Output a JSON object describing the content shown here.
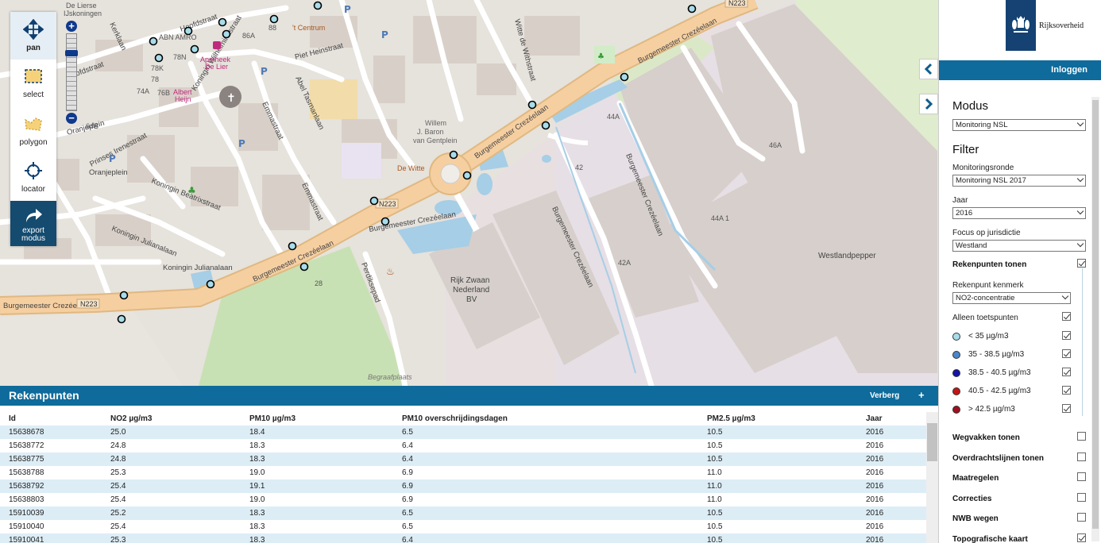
{
  "toolbar": {
    "pan": "pan",
    "select": "select",
    "polygon": "polygon",
    "locator": "locator",
    "export_line1": "export",
    "export_line2": "modus"
  },
  "map": {
    "streets": [
      "Hoofdstraat",
      "Piet Heinstraat",
      "Abel Tasmanlaan",
      "Emmastraat",
      "Koningin Wilhelminastraat",
      "Koningin Beatrixstraat",
      "Koningin Julianalaan",
      "Prinses Irenestraat",
      "Oranjeplein",
      "Witte de Withstraat",
      "Burgemeester Crezéelaan",
      "Burgemeester Crezéelaan",
      "Burgemeester Crezéelaan",
      "Burgemeester Crezéelaan",
      "Burgemeester Crezéelaan",
      "Burgemeester Crezéelaan",
      "Burgemeester Crezéelaan",
      "Perdiksepad",
      "Oranjeplein",
      "Kerklaan"
    ],
    "pois": [
      "ABN AMRO",
      "Apotheek De Lier",
      "Albert Heijn",
      "De Lierse IJskoningen",
      "'t Centrum",
      "Willem J. Baron van Gentplein",
      "De Witte",
      "Rijk Zwaan Nederland BV",
      "Westlandpepper",
      "Begraafplaats"
    ],
    "road_badges": [
      "N223",
      "N223",
      "N223"
    ],
    "house_numbers": [
      "78N",
      "78K",
      "76B",
      "64B",
      "86A",
      "88",
      "42",
      "44A",
      "46A",
      "44A 1",
      "42A",
      "28",
      "74A",
      "78"
    ]
  },
  "panel": {
    "logo_text": "Rijksoverheid",
    "login": "Inloggen",
    "modus_title": "Modus",
    "modus_value": "Monitoring NSL",
    "filter_title": "Filter",
    "ronde_label": "Monitoringsronde",
    "ronde_value": "Monitoring NSL 2017",
    "jaar_label": "Jaar",
    "jaar_value": "2016",
    "focus_label": "Focus op jurisdictie",
    "focus_value": "Westland",
    "rekenpunten_tonen": "Rekenpunten tonen",
    "kenmerk_label": "Rekenpunt kenmerk",
    "kenmerk_value": "NO2-concentratie",
    "alleen_toetspunten": "Alleen toetspunten",
    "legend": [
      {
        "label": "< 35 µg/m3",
        "color": "#a8dcea"
      },
      {
        "label": "35 - 38.5 µg/m3",
        "color": "#4a86c8"
      },
      {
        "label": "38.5 - 40.5 µg/m3",
        "color": "#1414a8"
      },
      {
        "label": "40.5 - 42.5 µg/m3",
        "color": "#c81414"
      },
      {
        "label": "> 42.5 µg/m3",
        "color": "#a01020"
      }
    ],
    "options": [
      {
        "label": "Wegvakken tonen",
        "checked": false
      },
      {
        "label": "Overdrachtslijnen tonen",
        "checked": false
      },
      {
        "label": "Maatregelen",
        "checked": false
      },
      {
        "label": "Correcties",
        "checked": false
      },
      {
        "label": "NWB wegen",
        "checked": false
      },
      {
        "label": "Topografische kaart",
        "checked": true
      }
    ]
  },
  "table": {
    "title": "Rekenpunten",
    "hide": "Verberg",
    "plus": "+",
    "columns": [
      "Id",
      "NO2 µg/m3",
      "PM10 µg/m3",
      "PM10 overschrijdingsdagen",
      "PM2.5 µg/m3",
      "Jaar"
    ],
    "rows": [
      [
        "15638678",
        "25.0",
        "18.4",
        "6.5",
        "10.5",
        "2016"
      ],
      [
        "15638772",
        "24.8",
        "18.3",
        "6.4",
        "10.5",
        "2016"
      ],
      [
        "15638775",
        "24.8",
        "18.3",
        "6.4",
        "10.5",
        "2016"
      ],
      [
        "15638788",
        "25.3",
        "19.0",
        "6.9",
        "11.0",
        "2016"
      ],
      [
        "15638792",
        "25.4",
        "19.1",
        "6.9",
        "11.0",
        "2016"
      ],
      [
        "15638803",
        "25.4",
        "19.0",
        "6.9",
        "11.0",
        "2016"
      ],
      [
        "15910039",
        "25.2",
        "18.3",
        "6.5",
        "10.5",
        "2016"
      ],
      [
        "15910040",
        "25.4",
        "18.3",
        "6.5",
        "10.5",
        "2016"
      ],
      [
        "15910041",
        "25.3",
        "18.3",
        "6.4",
        "10.5",
        "2016"
      ]
    ]
  },
  "colors": {
    "brand_blue": "#0e6b9b",
    "dark_blue": "#154273",
    "row_alt": "#ddedf6",
    "point_fill": "#a8dcea"
  }
}
